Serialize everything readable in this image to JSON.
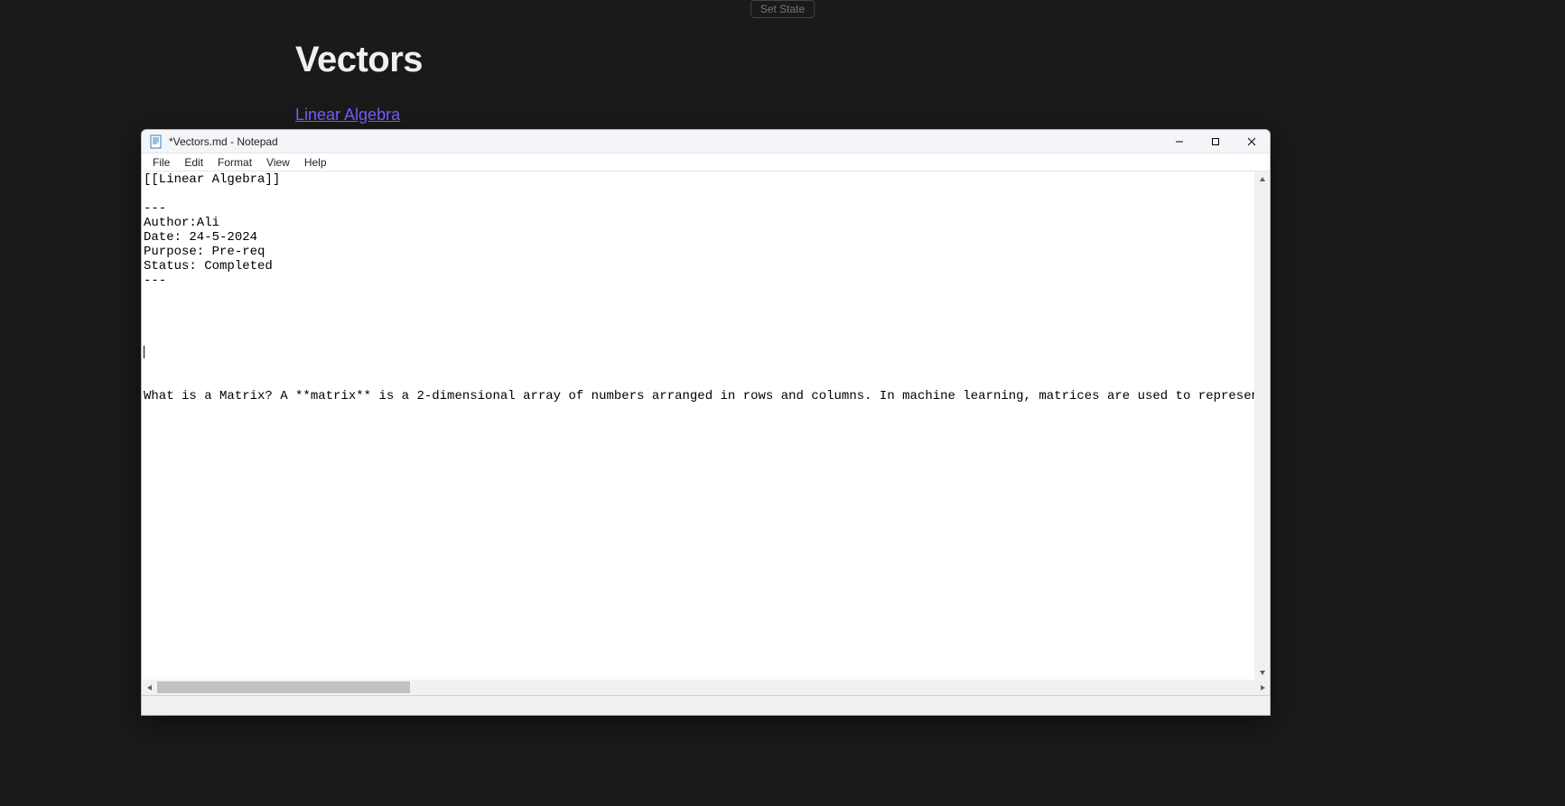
{
  "setStateLabel": "Set State",
  "background": {
    "heading": "Vectors",
    "link": "Linear Algebra"
  },
  "notepad": {
    "title": "*Vectors.md - Notepad",
    "menu": [
      "File",
      "Edit",
      "Format",
      "View",
      "Help"
    ],
    "content_lines": [
      "[[Linear Algebra]]",
      "",
      "---",
      "Author:Ali",
      "Date: 24-5-2024",
      "Purpose: Pre-req",
      "Status: Completed",
      "---",
      "",
      "",
      "",
      "",
      "",
      "",
      "",
      "What is a Matrix? A **matrix** is a 2-dimensional array of numbers arranged in rows and columns. In machine learning, matrices are used to represent datasets (where each row r"
    ],
    "caret_line_index": 12
  }
}
